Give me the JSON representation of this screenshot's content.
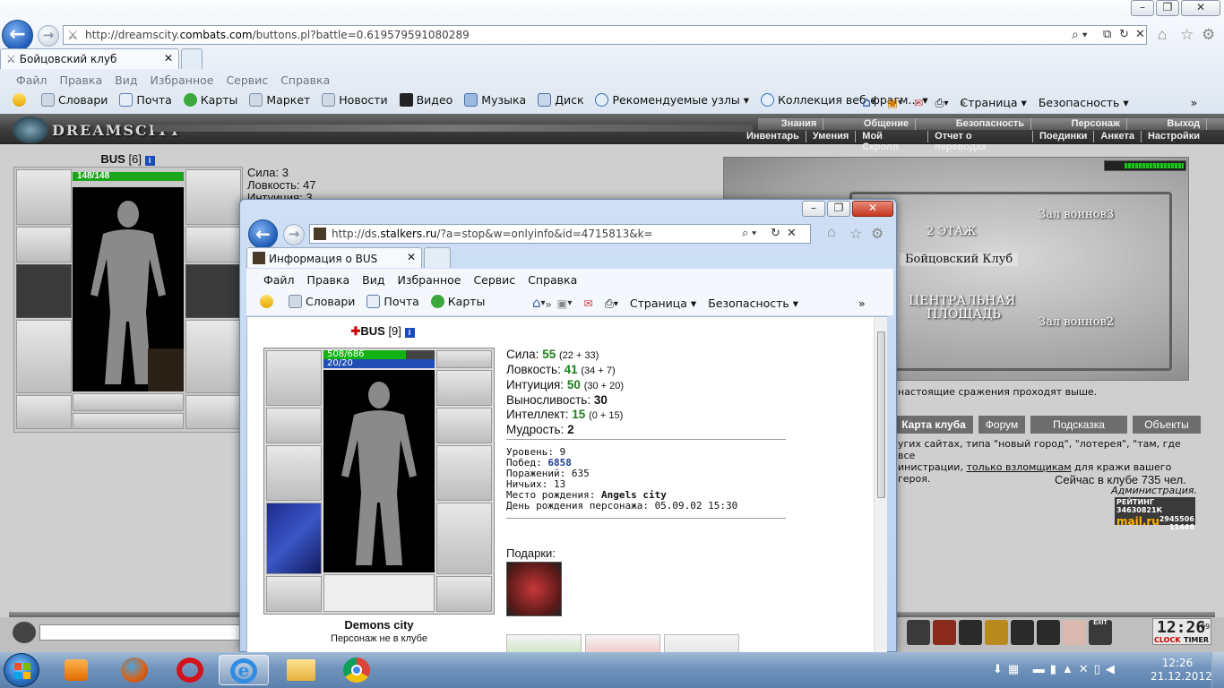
{
  "browser": {
    "url_prefix": "http://dreamscity.",
    "url_domain": "combats.com",
    "url_rest": "/buttons.pl?battle=0.619579591080289",
    "tab_title": "Бойцовский клуб",
    "menu": [
      "Файл",
      "Правка",
      "Вид",
      "Избранное",
      "Сервис",
      "Справка"
    ],
    "favorites": [
      "Словари",
      "Почта",
      "Карты",
      "Маркет",
      "Новости",
      "Видео",
      "Музыка",
      "Диск",
      "Рекомендуемые узлы",
      "Коллекция веб-фрагм..."
    ],
    "toolbar_right": {
      "page": "Страница",
      "security": "Безопасность"
    }
  },
  "game": {
    "logo": "DREAMSCITY",
    "nav_top": [
      "Знания",
      "Общение",
      "Безопасность",
      "Персонаж",
      "Выход"
    ],
    "nav_bottom": [
      "Инвентарь",
      "Умения",
      "Мой Скролл",
      "Отчет о переводах",
      "Поединки",
      "Анкета",
      "Настройки"
    ],
    "char": {
      "name": "BUS",
      "level": "[6]",
      "hp": "148/148"
    },
    "stats": [
      "Сила: 3",
      "Ловкость: 47",
      "Интуиция: 3"
    ],
    "map": {
      "floor": "2 ЭТАЖ",
      "hall3": "Зал воинов3",
      "club": "Бойцовский Клуб",
      "square1": "ЦЕНТРАЛЬНАЯ",
      "square2": "ПЛОЩАДЬ",
      "hall2": "Зал воинов2"
    },
    "notice": "настоящие сражения проходят выше.",
    "buttons": [
      "Карта клуба",
      "Форум",
      "Подсказка",
      "Объекты"
    ],
    "warning_1": "угих сайтах, типа \"новый город\", \"лотерея\", \"там, где все",
    "warning_2a": "инистрации, ",
    "warning_link": "только взломщикам",
    "warning_2b": " для кражи вашего героя.",
    "admin": "Администрация.",
    "online": "Сейчас в клубе 735 чел.",
    "counter": {
      "label": "РЕЙТИНГ",
      "v1": "34630821К",
      "brand": "mail.ru",
      "v2": "2945506",
      "v3": "11446"
    },
    "clock": "12:26",
    "clock_sec": "09",
    "clock_labels": {
      "clock": "CLOCK",
      "timer": "TIMER"
    },
    "exit_label": "EXIT"
  },
  "popup": {
    "url_prefix": "http://ds.",
    "url_domain": "stalkers.ru",
    "url_rest": "/?a=stop&w=onlyinfo&id=4715813&k=",
    "tab_title": "Информация о BUS",
    "menu": [
      "Файл",
      "Правка",
      "Вид",
      "Избранное",
      "Сервис",
      "Справка"
    ],
    "favorites": [
      "Словари",
      "Почта",
      "Карты"
    ],
    "toolbar_right": {
      "page": "Страница",
      "security": "Безопасность"
    },
    "char": {
      "name": "BUS",
      "level": "[9]",
      "hp": "508/686",
      "mana": "20/20",
      "hp_fraction": 0.74,
      "mana_fraction": 1.0
    },
    "stats": [
      {
        "label": "Сила:",
        "value": "55",
        "detail": "(22 + 33)"
      },
      {
        "label": "Ловкость:",
        "value": "41",
        "detail": "(34 + 7)"
      },
      {
        "label": "Интуиция:",
        "value": "50",
        "detail": "(30 + 20)"
      },
      {
        "label": "Выносливость:",
        "value": "30",
        "detail": ""
      },
      {
        "label": "Интеллект:",
        "value": "15",
        "detail": "(0 + 15)"
      },
      {
        "label": "Мудрость:",
        "value": "2",
        "detail": ""
      }
    ],
    "info": {
      "level": "Уровень: 9",
      "wins_label": "Побед: ",
      "wins": "6858",
      "losses": "Поражений: 635",
      "draws": "Ничьих: 13",
      "birthplace_label": "Место рождения: ",
      "birthplace": "Angels city",
      "birthday": "День рождения персонажа: 05.09.02 15:30"
    },
    "gifts": "Подарки:",
    "city": "Demons city",
    "status": "Персонаж не в клубе"
  },
  "taskbar": {
    "time": "12:26",
    "date": "21.12.2012"
  },
  "colors": {
    "accent": "#1f5cb8",
    "hp": "#11b211",
    "mana": "#1f4fb5",
    "green_stat": "#1b7f1b",
    "link": "#1f3d8f"
  }
}
